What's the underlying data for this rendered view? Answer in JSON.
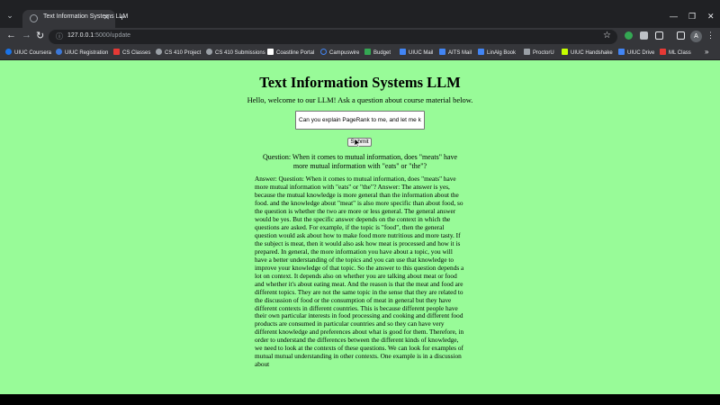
{
  "tab": {
    "title": "Text Information Systems LLM"
  },
  "toolbar": {
    "url_host": "127.0.0.1",
    "url_path": ":5000/update",
    "avatar_letter": "A"
  },
  "bookmarks": [
    {
      "label": "UIUC Coursera",
      "color": "#1a73e8"
    },
    {
      "label": "UIUC Registration",
      "color": "#3c78d8"
    },
    {
      "label": "CS Classes",
      "color": "#e53935"
    },
    {
      "label": "CS 410 Project",
      "color": "#9aa0a6"
    },
    {
      "label": "CS 410 Submissions",
      "color": "#9aa0a6"
    },
    {
      "label": "Coastline Portal",
      "color": "#ffffff"
    },
    {
      "label": "Campuswire",
      "color": "#4285f4"
    },
    {
      "label": "Budget",
      "color": "#34a853"
    },
    {
      "label": "UIUC Mail",
      "color": "#4285f4"
    },
    {
      "label": "AITS Mail",
      "color": "#4285f4"
    },
    {
      "label": "LinAlg Book",
      "color": "#4285f4"
    },
    {
      "label": "ProctorU",
      "color": "#9aa0a6"
    },
    {
      "label": "UIUC Handshake",
      "color": "#c6ff00"
    },
    {
      "label": "UIUC Drive",
      "color": "#4285f4"
    },
    {
      "label": "ML Class",
      "color": "#e53935"
    }
  ],
  "page": {
    "title": "Text Information Systems LLM",
    "welcome": "Hello, welcome to our LLM! Ask a question about course material below.",
    "input_value": "Can you explain PageRank to me, and let me know",
    "submit_label": "Submit",
    "question": "Question: When it comes to mutual information, does \"meats\" have more mutual information with \"eats\" or \"the\"?",
    "answer": "Answer: Question: When it comes to mutual information, does \"meats\" have more mutual information with \"eats\" or \"the\"? Answer: The answer is yes, because the mutual knowledge is more general than the information about the food. and the knowledge about \"meat\" is also more specific than about food, so the question is whether the two are more or less general. The general answer would be yes. But the specific answer depends on the context in which the questions are asked. For example, if the topic is \"food\", then the general question would ask about how to make food more nutritious and more tasty. If the subject is meat, then it would also ask how meat is processed and how it is prepared. In general, the more information you have about a topic, you will have a better understanding of the topics and you can use that knowledge to improve your knowledge of that topic. So the answer to this question depends a lot on context. It depends also on whether you are talking about meat or food and whether it's about eating meat. And the reason is that the meat and food are different topics. They are not the same topic in the sense that they are related to the discussion of food or the consumption of meat in general but they have different contexts in different countries. This is because different people have their own particular interests in food processing and cooking and different food products are consumed in particular countries and so they can have very different knowledge and preferences about what is good for them. Therefore, in order to understand the differences between the different kinds of knowledge, we need to look at the contexts of these questions. We can look for examples of mutual mutual understanding in other contexts. One example is in a discussion about"
  }
}
